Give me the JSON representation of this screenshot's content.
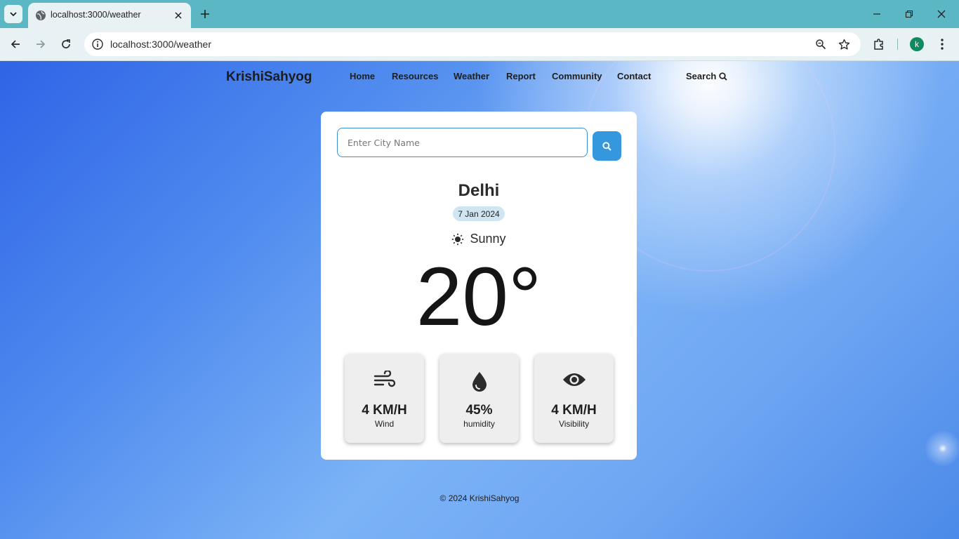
{
  "browser": {
    "tab_title": "localhost:3000/weather",
    "url": "localhost:3000/weather",
    "profile_initial": "k"
  },
  "nav": {
    "brand": "KrishiSahyog",
    "links": [
      "Home",
      "Resources",
      "Weather",
      "Report",
      "Community",
      "Contact"
    ],
    "search_label": "Search"
  },
  "weather": {
    "search_placeholder": "Enter City Name",
    "city": "Delhi",
    "date": "7 Jan 2024",
    "condition": "Sunny",
    "temperature": "20°",
    "stats": [
      {
        "icon": "wind-icon",
        "value": "4 KM/H",
        "label": "Wind"
      },
      {
        "icon": "water-drop-icon",
        "value": "45%",
        "label": "humidity"
      },
      {
        "icon": "eye-icon",
        "value": "4 KM/H",
        "label": "Visibility"
      }
    ]
  },
  "footer": {
    "text": "© 2024 KrishiSahyog"
  },
  "colors": {
    "tab_strip": "#5bb7c3",
    "search_button": "#3597dd",
    "date_pill": "#cfe6f2"
  }
}
